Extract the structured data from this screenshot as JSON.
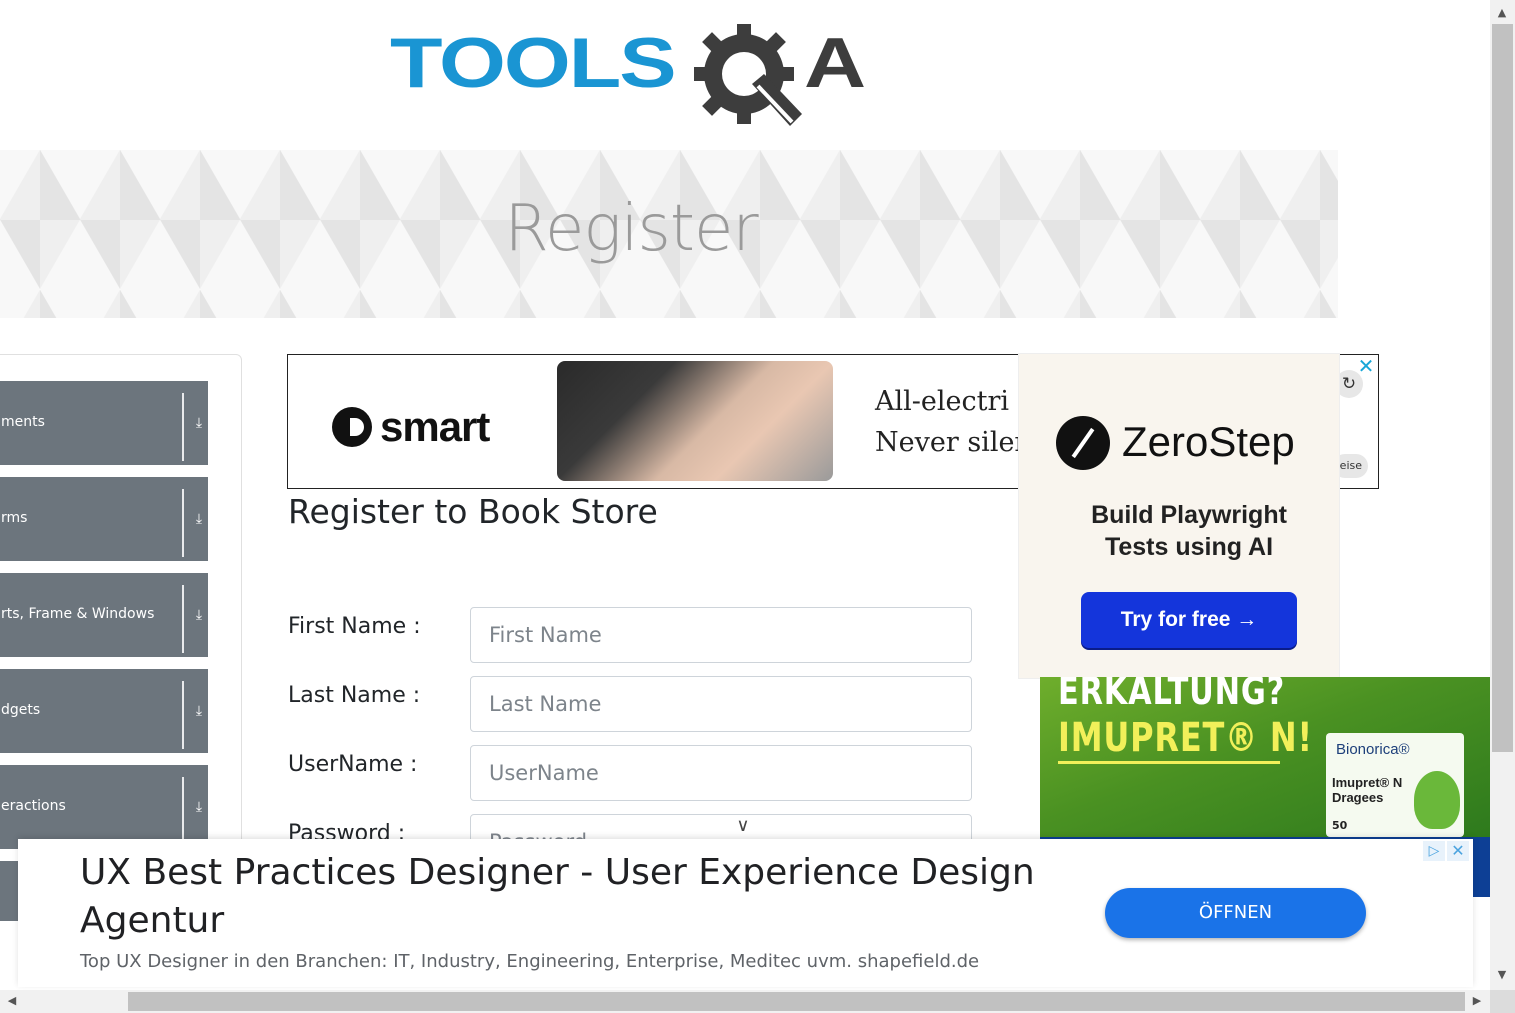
{
  "logo": {
    "text_main": "TOOLS",
    "text_q": "Q",
    "text_end": "A"
  },
  "banner": {
    "title": "Register"
  },
  "sidebar": {
    "groups": [
      {
        "label": "ments"
      },
      {
        "label": "rms"
      },
      {
        "label": "rts, Frame & Windows"
      },
      {
        "label": "dgets"
      },
      {
        "label": "eractions"
      }
    ]
  },
  "ads": {
    "smart": {
      "brand": "smart",
      "line1": "All-electri",
      "line2": "Never siler"
    },
    "zerostep": {
      "brand": "ZeroStep",
      "tagline_1": "Build Playwright",
      "tagline_2": "Tests using AI",
      "cta": "Try for free →",
      "hint": "eise"
    },
    "imupret": {
      "line1": "ERKALTUNG?",
      "line2": "IMUPRET® N!",
      "brand": "Bionorica®",
      "product": "Imupret® N Dragees",
      "count": "50"
    },
    "bottom": {
      "title": "UX Best Practices Designer - User Experience Design Agentur",
      "description": "Top UX Designer in den Branchen: IT, Industry, Engineering, Enterprise, Meditec uvm. shapefield.de",
      "cta": "ÖFFNEN"
    }
  },
  "form": {
    "heading": "Register to Book Store",
    "fields": [
      {
        "label": "First Name :",
        "placeholder": "First Name"
      },
      {
        "label": "Last Name :",
        "placeholder": "Last Name"
      },
      {
        "label": "UserName :",
        "placeholder": "UserName"
      },
      {
        "label": "Password :",
        "placeholder": "Password"
      }
    ]
  },
  "icons": {
    "download": "⤓",
    "close": "✕",
    "refresh": "↻",
    "chevron_down": "∨",
    "ad_choices": "▷",
    "scroll_up": "▲",
    "scroll_down": "▼",
    "scroll_left": "◀",
    "scroll_right": "▶"
  }
}
